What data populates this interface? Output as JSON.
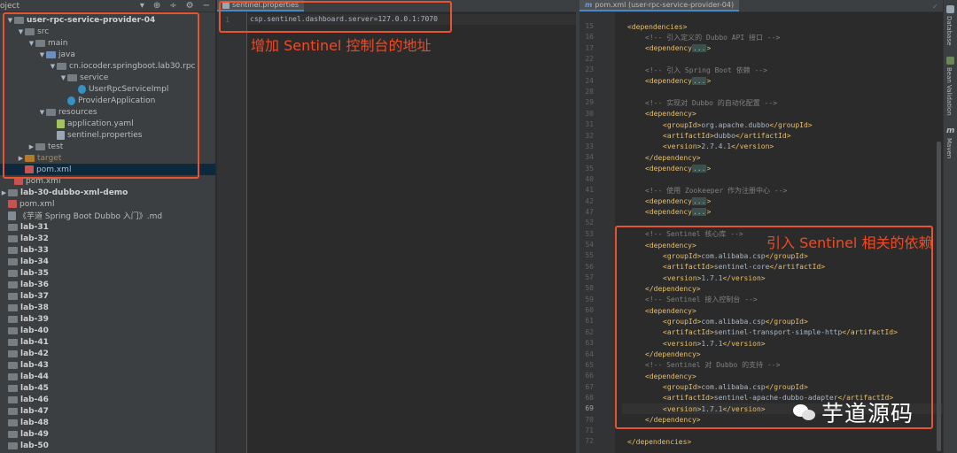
{
  "project": {
    "header_title": "oject",
    "rows": [
      {
        "label": "user-rpc-service-provider-04",
        "indent": 0,
        "arrow": "▼",
        "icon": "folder-grey",
        "bold": true
      },
      {
        "label": "src",
        "indent": 1,
        "arrow": "▼",
        "icon": "folder-grey"
      },
      {
        "label": "main",
        "indent": 2,
        "arrow": "▼",
        "icon": "folder-grey"
      },
      {
        "label": "java",
        "indent": 3,
        "arrow": "▼",
        "icon": "folder-blue"
      },
      {
        "label": "cn.iocoder.springboot.lab30.rpc",
        "indent": 4,
        "arrow": "▼",
        "icon": "folder-grey"
      },
      {
        "label": "service",
        "indent": 5,
        "arrow": "▼",
        "icon": "folder-grey"
      },
      {
        "label": "UserRpcServiceImpl",
        "indent": 6,
        "arrow": "",
        "icon": "class"
      },
      {
        "label": "ProviderApplication",
        "indent": 5,
        "arrow": "",
        "icon": "class"
      },
      {
        "label": "resources",
        "indent": 3,
        "arrow": "▼",
        "icon": "folder-grey"
      },
      {
        "label": "application.yaml",
        "indent": 4,
        "arrow": "",
        "icon": "yaml"
      },
      {
        "label": "sentinel.properties",
        "indent": 4,
        "arrow": "",
        "icon": "props"
      },
      {
        "label": "test",
        "indent": 2,
        "arrow": "▶",
        "icon": "folder-grey"
      },
      {
        "label": "target",
        "indent": 1,
        "arrow": "▶",
        "icon": "folder-orange",
        "dim": true
      },
      {
        "label": "pom.xml",
        "indent": 1,
        "arrow": "",
        "icon": "maven",
        "selected": true
      },
      {
        "label": "pom.xml",
        "indent": 0,
        "arrow": "",
        "icon": "maven"
      },
      {
        "label": "lab-30-dubbo-xml-demo",
        "indent": -1,
        "arrow": "▶",
        "icon": "folder-grey",
        "bold": true
      },
      {
        "label": "pom.xml",
        "indent": -1,
        "arrow": "",
        "icon": "maven"
      },
      {
        "label": "《芋道 Spring Boot Dubbo 入门》.md",
        "indent": -1,
        "arrow": "",
        "icon": "md"
      },
      {
        "label": "lab-31",
        "indent": -2,
        "arrow": "",
        "icon": "folder-grey",
        "bold": true
      },
      {
        "label": "lab-32",
        "indent": -2,
        "arrow": "",
        "icon": "folder-grey",
        "bold": true
      },
      {
        "label": "lab-33",
        "indent": -2,
        "arrow": "",
        "icon": "folder-grey",
        "bold": true
      },
      {
        "label": "lab-34",
        "indent": -2,
        "arrow": "",
        "icon": "folder-grey",
        "bold": true
      },
      {
        "label": "lab-35",
        "indent": -2,
        "arrow": "",
        "icon": "folder-grey",
        "bold": true
      },
      {
        "label": "lab-36",
        "indent": -2,
        "arrow": "",
        "icon": "folder-grey",
        "bold": true
      },
      {
        "label": "lab-37",
        "indent": -2,
        "arrow": "",
        "icon": "folder-grey",
        "bold": true
      },
      {
        "label": "lab-38",
        "indent": -2,
        "arrow": "",
        "icon": "folder-grey",
        "bold": true
      },
      {
        "label": "lab-39",
        "indent": -2,
        "arrow": "",
        "icon": "folder-grey",
        "bold": true
      },
      {
        "label": "lab-40",
        "indent": -2,
        "arrow": "",
        "icon": "folder-grey",
        "bold": true
      },
      {
        "label": "lab-41",
        "indent": -2,
        "arrow": "",
        "icon": "folder-grey",
        "bold": true
      },
      {
        "label": "lab-42",
        "indent": -2,
        "arrow": "",
        "icon": "folder-grey",
        "bold": true
      },
      {
        "label": "lab-43",
        "indent": -2,
        "arrow": "",
        "icon": "folder-grey",
        "bold": true
      },
      {
        "label": "lab-44",
        "indent": -2,
        "arrow": "",
        "icon": "folder-grey",
        "bold": true
      },
      {
        "label": "lab-45",
        "indent": -2,
        "arrow": "",
        "icon": "folder-grey",
        "bold": true
      },
      {
        "label": "lab-46",
        "indent": -2,
        "arrow": "",
        "icon": "folder-grey",
        "bold": true
      },
      {
        "label": "lab-47",
        "indent": -2,
        "arrow": "",
        "icon": "folder-grey",
        "bold": true
      },
      {
        "label": "lab-48",
        "indent": -2,
        "arrow": "",
        "icon": "folder-grey",
        "bold": true
      },
      {
        "label": "lab-49",
        "indent": -2,
        "arrow": "",
        "icon": "folder-grey",
        "bold": true
      },
      {
        "label": "lab-50",
        "indent": -2,
        "arrow": "",
        "icon": "folder-grey",
        "bold": true
      }
    ]
  },
  "editor_left": {
    "tab_label": "sentinel.properties",
    "line_number": "1",
    "code": "csp.sentinel.dashboard.server=127.0.0.1:7070",
    "annotation": "增加 Sentinel 控制台的地址"
  },
  "editor_right": {
    "tab_label": "pom.xml (user-rpc-service-provider-04)",
    "annotation": "引入 Sentinel 相关的依赖",
    "current_line": "69",
    "lines": [
      {
        "n": "15",
        "ind": 1,
        "parts": [
          [
            "tag",
            "<dependencies>"
          ]
        ]
      },
      {
        "n": "16",
        "ind": 2,
        "parts": [
          [
            "cm",
            "<!-- 引入定义的 Dubbo API 接口 -->"
          ]
        ]
      },
      {
        "n": "17",
        "ind": 2,
        "parts": [
          [
            "tag",
            "<dependency"
          ],
          [
            "ellip",
            "..."
          ],
          [
            "tag",
            ">"
          ]
        ]
      },
      {
        "n": "22",
        "ind": 0,
        "parts": []
      },
      {
        "n": "23",
        "ind": 2,
        "parts": [
          [
            "cm",
            "<!-- 引入 Spring Boot 依赖 -->"
          ]
        ]
      },
      {
        "n": "24",
        "ind": 2,
        "parts": [
          [
            "tag",
            "<dependency"
          ],
          [
            "ellip",
            "..."
          ],
          [
            "tag",
            ">"
          ]
        ]
      },
      {
        "n": "28",
        "ind": 0,
        "parts": []
      },
      {
        "n": "29",
        "ind": 2,
        "parts": [
          [
            "cm",
            "<!-- 实现对 Dubbo 的自动化配置 -->"
          ]
        ]
      },
      {
        "n": "30",
        "ind": 2,
        "parts": [
          [
            "tag",
            "<dependency>"
          ]
        ]
      },
      {
        "n": "31",
        "ind": 3,
        "parts": [
          [
            "tag",
            "<groupId>"
          ],
          [
            "txt",
            "org.apache.dubbo"
          ],
          [
            "tag",
            "</groupId>"
          ]
        ]
      },
      {
        "n": "32",
        "ind": 3,
        "parts": [
          [
            "tag",
            "<artifactId>"
          ],
          [
            "txt",
            "dubbo"
          ],
          [
            "tag",
            "</artifactId>"
          ]
        ]
      },
      {
        "n": "33",
        "ind": 3,
        "parts": [
          [
            "tag",
            "<version>"
          ],
          [
            "txt",
            "2.7.4.1"
          ],
          [
            "tag",
            "</version>"
          ]
        ]
      },
      {
        "n": "34",
        "ind": 2,
        "parts": [
          [
            "tag",
            "</dependency>"
          ]
        ]
      },
      {
        "n": "35",
        "ind": 2,
        "parts": [
          [
            "tag",
            "<dependency"
          ],
          [
            "ellip",
            "..."
          ],
          [
            "tag",
            ">"
          ]
        ]
      },
      {
        "n": "40",
        "ind": 0,
        "parts": []
      },
      {
        "n": "41",
        "ind": 2,
        "parts": [
          [
            "cm",
            "<!-- 使用 Zookeeper 作为注册中心 -->"
          ]
        ]
      },
      {
        "n": "42",
        "ind": 2,
        "parts": [
          [
            "tag",
            "<dependency"
          ],
          [
            "ellip",
            "..."
          ],
          [
            "tag",
            ">"
          ]
        ]
      },
      {
        "n": "47",
        "ind": 2,
        "parts": [
          [
            "tag",
            "<dependency"
          ],
          [
            "ellip",
            "..."
          ],
          [
            "tag",
            ">"
          ]
        ]
      },
      {
        "n": "52",
        "ind": 0,
        "parts": []
      },
      {
        "n": "53",
        "ind": 2,
        "parts": [
          [
            "cm",
            "<!-- Sentinel 核心库 -->"
          ]
        ]
      },
      {
        "n": "54",
        "ind": 2,
        "parts": [
          [
            "tag",
            "<dependency>"
          ]
        ]
      },
      {
        "n": "55",
        "ind": 3,
        "parts": [
          [
            "tag",
            "<groupId>"
          ],
          [
            "txt",
            "com.alibaba.csp"
          ],
          [
            "tag",
            "</groupId>"
          ]
        ]
      },
      {
        "n": "56",
        "ind": 3,
        "parts": [
          [
            "tag",
            "<artifactId>"
          ],
          [
            "txt",
            "sentinel-core"
          ],
          [
            "tag",
            "</artifactId>"
          ]
        ]
      },
      {
        "n": "57",
        "ind": 3,
        "parts": [
          [
            "tag",
            "<version>"
          ],
          [
            "txt",
            "1.7.1"
          ],
          [
            "tag",
            "</version>"
          ]
        ]
      },
      {
        "n": "58",
        "ind": 2,
        "parts": [
          [
            "tag",
            "</dependency>"
          ]
        ]
      },
      {
        "n": "59",
        "ind": 2,
        "parts": [
          [
            "cm",
            "<!-- Sentinel 接入控制台 -->"
          ]
        ]
      },
      {
        "n": "60",
        "ind": 2,
        "parts": [
          [
            "tag",
            "<dependency>"
          ]
        ]
      },
      {
        "n": "61",
        "ind": 3,
        "parts": [
          [
            "tag",
            "<groupId>"
          ],
          [
            "txt",
            "com.alibaba.csp"
          ],
          [
            "tag",
            "</groupId>"
          ]
        ]
      },
      {
        "n": "62",
        "ind": 3,
        "parts": [
          [
            "tag",
            "<artifactId>"
          ],
          [
            "txt",
            "sentinel-transport-simple-http"
          ],
          [
            "tag",
            "</artifactId>"
          ]
        ]
      },
      {
        "n": "63",
        "ind": 3,
        "parts": [
          [
            "tag",
            "<version>"
          ],
          [
            "txt",
            "1.7.1"
          ],
          [
            "tag",
            "</version>"
          ]
        ]
      },
      {
        "n": "64",
        "ind": 2,
        "parts": [
          [
            "tag",
            "</dependency>"
          ]
        ]
      },
      {
        "n": "65",
        "ind": 2,
        "parts": [
          [
            "cm",
            "<!-- Sentinel 对 Dubbo 的支持 -->"
          ]
        ]
      },
      {
        "n": "66",
        "ind": 2,
        "parts": [
          [
            "tag",
            "<dependency>"
          ]
        ]
      },
      {
        "n": "67",
        "ind": 3,
        "parts": [
          [
            "tag",
            "<groupId>"
          ],
          [
            "txt",
            "com.alibaba.csp"
          ],
          [
            "tag",
            "</groupId>"
          ]
        ]
      },
      {
        "n": "68",
        "ind": 3,
        "parts": [
          [
            "tag",
            "<artifactId>"
          ],
          [
            "txt",
            "sentinel-apache-dubbo-adapter"
          ],
          [
            "tag",
            "</artifactId>"
          ]
        ]
      },
      {
        "n": "69",
        "ind": 3,
        "parts": [
          [
            "tag",
            "<version>"
          ],
          [
            "txt",
            "1.7.1"
          ],
          [
            "tag",
            "</version>"
          ]
        ]
      },
      {
        "n": "70",
        "ind": 2,
        "parts": [
          [
            "tag",
            "</dependency>"
          ]
        ]
      },
      {
        "n": "71",
        "ind": 0,
        "parts": []
      },
      {
        "n": "72",
        "ind": 1,
        "parts": [
          [
            "tag",
            "</dependencies>"
          ]
        ]
      }
    ]
  },
  "right_strip": {
    "items": [
      "Database",
      "Bean Validation",
      "Maven"
    ]
  },
  "watermark": {
    "text": "芋道源码"
  },
  "colors": {
    "annotation": "#e8542f",
    "tag": "#e8bf6a",
    "comment": "#808080",
    "bg": "#2b2b2b"
  }
}
